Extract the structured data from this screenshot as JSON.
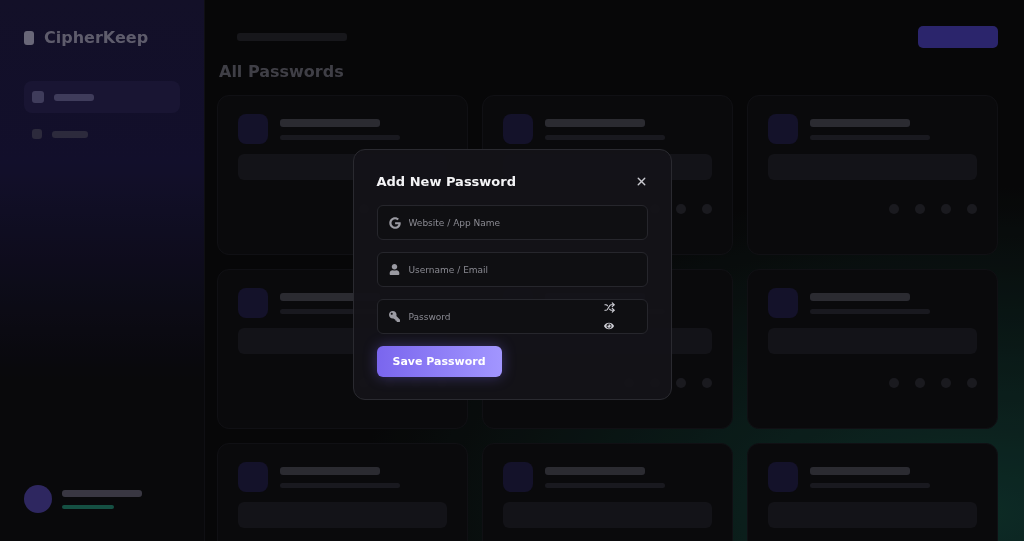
{
  "app": {
    "brand": "CipherKeep",
    "heading": "All Passwords"
  },
  "dialog": {
    "title": "Add New Password",
    "fields": [
      {
        "kind": "website",
        "placeholder": "Website / App Name"
      },
      {
        "kind": "username",
        "placeholder": "Username / Email"
      },
      {
        "kind": "password",
        "placeholder": "Password"
      }
    ],
    "submit": "Save Password"
  }
}
